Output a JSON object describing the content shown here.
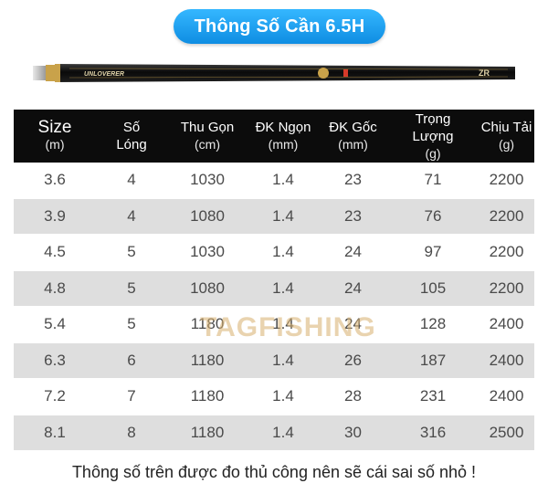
{
  "title": "Thông Số Cần 6.5H",
  "rod": {
    "brand_text": "UNLOVERER",
    "accent_color": "#c9a24a"
  },
  "table": {
    "headers": [
      {
        "label": "Size",
        "unit": "(m)"
      },
      {
        "label": "Số Lóng",
        "unit": ""
      },
      {
        "label": "Thu Gọn",
        "unit": "(cm)"
      },
      {
        "label": "ĐK Ngọn",
        "unit": "(mm)"
      },
      {
        "label": "ĐK Gốc",
        "unit": "(mm)"
      },
      {
        "label": "Trọng Lượng",
        "unit": "(g)"
      },
      {
        "label": "Chịu Tải",
        "unit": "(g)"
      }
    ],
    "rows": [
      [
        "3.6",
        "4",
        "1030",
        "1.4",
        "23",
        "71",
        "2200"
      ],
      [
        "3.9",
        "4",
        "1080",
        "1.4",
        "23",
        "76",
        "2200"
      ],
      [
        "4.5",
        "5",
        "1030",
        "1.4",
        "24",
        "97",
        "2200"
      ],
      [
        "4.8",
        "5",
        "1080",
        "1.4",
        "24",
        "105",
        "2200"
      ],
      [
        "5.4",
        "5",
        "1180",
        "1.4",
        "24",
        "128",
        "2400"
      ],
      [
        "6.3",
        "6",
        "1180",
        "1.4",
        "26",
        "187",
        "2400"
      ],
      [
        "7.2",
        "7",
        "1180",
        "1.4",
        "28",
        "231",
        "2400"
      ],
      [
        "8.1",
        "8",
        "1180",
        "1.4",
        "30",
        "316",
        "2500"
      ]
    ]
  },
  "watermark": "TAGFISHING",
  "footnote": "Thông số trên được đo thủ công nên sẽ cái sai số nhỏ !"
}
